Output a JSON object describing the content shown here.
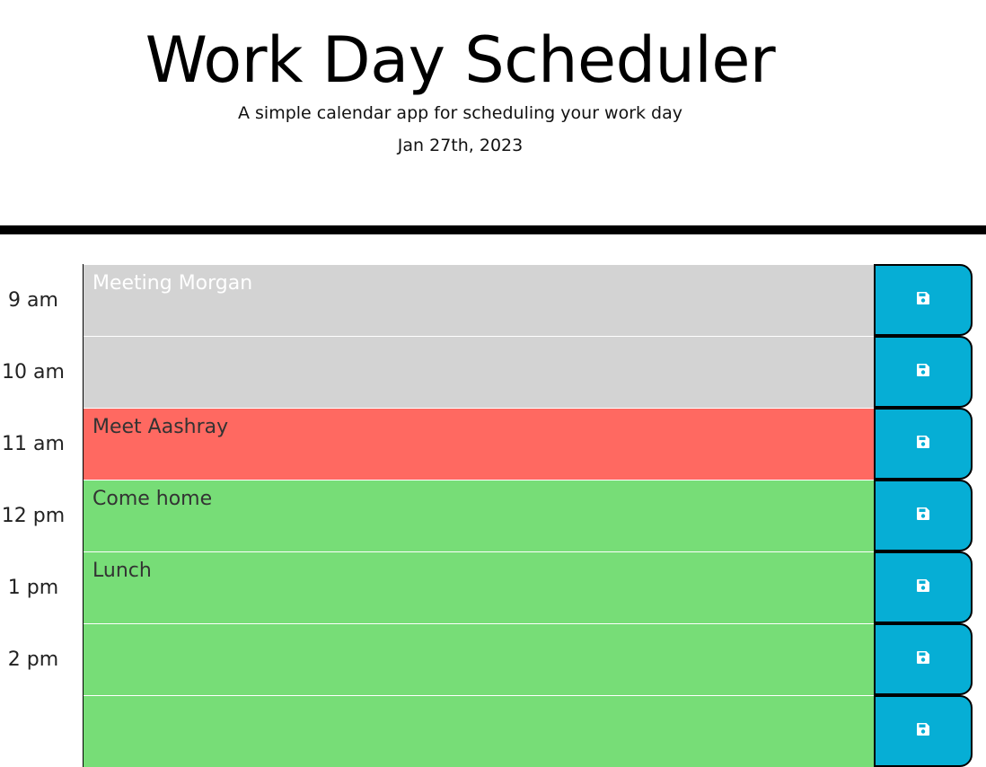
{
  "header": {
    "title": "Work Day Scheduler",
    "subtitle": "A simple calendar app for scheduling your work day",
    "current_day": "Jan 27th, 2023"
  },
  "colors": {
    "past": "#d3d3d3",
    "present": "#ff6961",
    "future": "#77dd77",
    "save_button": "#06aed5"
  },
  "rows": [
    {
      "hour": "9 am",
      "text": "Meeting Morgan",
      "state": "past",
      "save_icon": "floppy-disk-icon"
    },
    {
      "hour": "10 am",
      "text": "",
      "state": "past",
      "save_icon": "floppy-disk-icon"
    },
    {
      "hour": "11 am",
      "text": "Meet Aashray",
      "state": "present",
      "save_icon": "floppy-disk-icon"
    },
    {
      "hour": "12 pm",
      "text": "Come home",
      "state": "future",
      "save_icon": "floppy-disk-icon"
    },
    {
      "hour": "1 pm",
      "text": "Lunch",
      "state": "future",
      "save_icon": "floppy-disk-icon"
    },
    {
      "hour": "2 pm",
      "text": "",
      "state": "future",
      "save_icon": "floppy-disk-icon"
    },
    {
      "hour": "",
      "text": "",
      "state": "future",
      "save_icon": "floppy-disk-icon"
    }
  ]
}
